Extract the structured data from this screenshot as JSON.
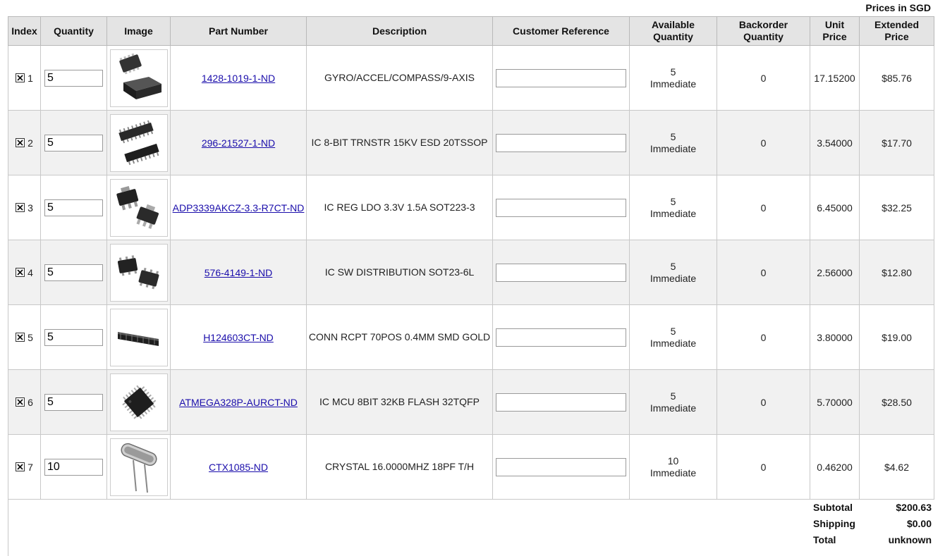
{
  "currency_note": "Prices in SGD",
  "headers": {
    "index": "Index",
    "quantity": "Quantity",
    "image": "Image",
    "part_number": "Part Number",
    "description": "Description",
    "customer_reference": "Customer Reference",
    "available_quantity_line1": "Available",
    "available_quantity_line2": "Quantity",
    "backorder_quantity_line1": "Backorder",
    "backorder_quantity_line2": "Quantity",
    "unit_price_line1": "Unit",
    "unit_price_line2": "Price",
    "extended_price_line1": "Extended",
    "extended_price_line2": "Price"
  },
  "rows": [
    {
      "index": "1",
      "quantity": "5",
      "part_number": "1428-1019-1-ND",
      "description": "GYRO/ACCEL/COMPASS/9-AXIS",
      "customer_reference": "",
      "available_qty": "5",
      "availability": "Immediate",
      "backorder_qty": "0",
      "unit_price": "17.15200",
      "extended_price": "$85.76",
      "image_icon": "qfn-chip-icon"
    },
    {
      "index": "2",
      "quantity": "5",
      "part_number": "296-21527-1-ND",
      "description": "IC 8-BIT TRNSTR 15KV ESD 20TSSOP",
      "customer_reference": "",
      "available_qty": "5",
      "availability": "Immediate",
      "backorder_qty": "0",
      "unit_price": "3.54000",
      "extended_price": "$17.70",
      "image_icon": "tssop-chip-icon"
    },
    {
      "index": "3",
      "quantity": "5",
      "part_number": "ADP3339AKCZ-3.3-R7CT-ND",
      "description": "IC REG LDO 3.3V 1.5A SOT223-3",
      "customer_reference": "",
      "available_qty": "5",
      "availability": "Immediate",
      "backorder_qty": "0",
      "unit_price": "6.45000",
      "extended_price": "$32.25",
      "image_icon": "sot223-chip-icon"
    },
    {
      "index": "4",
      "quantity": "5",
      "part_number": "576-4149-1-ND",
      "description": "IC SW DISTRIBUTION SOT23-6L",
      "customer_reference": "",
      "available_qty": "5",
      "availability": "Immediate",
      "backorder_qty": "0",
      "unit_price": "2.56000",
      "extended_price": "$12.80",
      "image_icon": "sot23-chip-icon"
    },
    {
      "index": "5",
      "quantity": "5",
      "part_number": "H124603CT-ND",
      "description": "CONN RCPT 70POS 0.4MM SMD GOLD",
      "customer_reference": "",
      "available_qty": "5",
      "availability": "Immediate",
      "backorder_qty": "0",
      "unit_price": "3.80000",
      "extended_price": "$19.00",
      "image_icon": "connector-icon"
    },
    {
      "index": "6",
      "quantity": "5",
      "part_number": "ATMEGA328P-AURCT-ND",
      "description": "IC MCU 8BIT 32KB FLASH 32TQFP",
      "customer_reference": "",
      "available_qty": "5",
      "availability": "Immediate",
      "backorder_qty": "0",
      "unit_price": "5.70000",
      "extended_price": "$28.50",
      "image_icon": "tqfp-chip-icon"
    },
    {
      "index": "7",
      "quantity": "10",
      "part_number": "CTX1085-ND",
      "description": "CRYSTAL 16.0000MHZ 18PF T/H",
      "customer_reference": "",
      "available_qty": "10",
      "availability": "Immediate",
      "backorder_qty": "0",
      "unit_price": "0.46200",
      "extended_price": "$4.62",
      "image_icon": "crystal-icon"
    }
  ],
  "totals": {
    "subtotal_label": "Subtotal",
    "subtotal_value": "$200.63",
    "shipping_label": "Shipping",
    "shipping_value": "$0.00",
    "total_label": "Total",
    "total_value": "unknown"
  }
}
